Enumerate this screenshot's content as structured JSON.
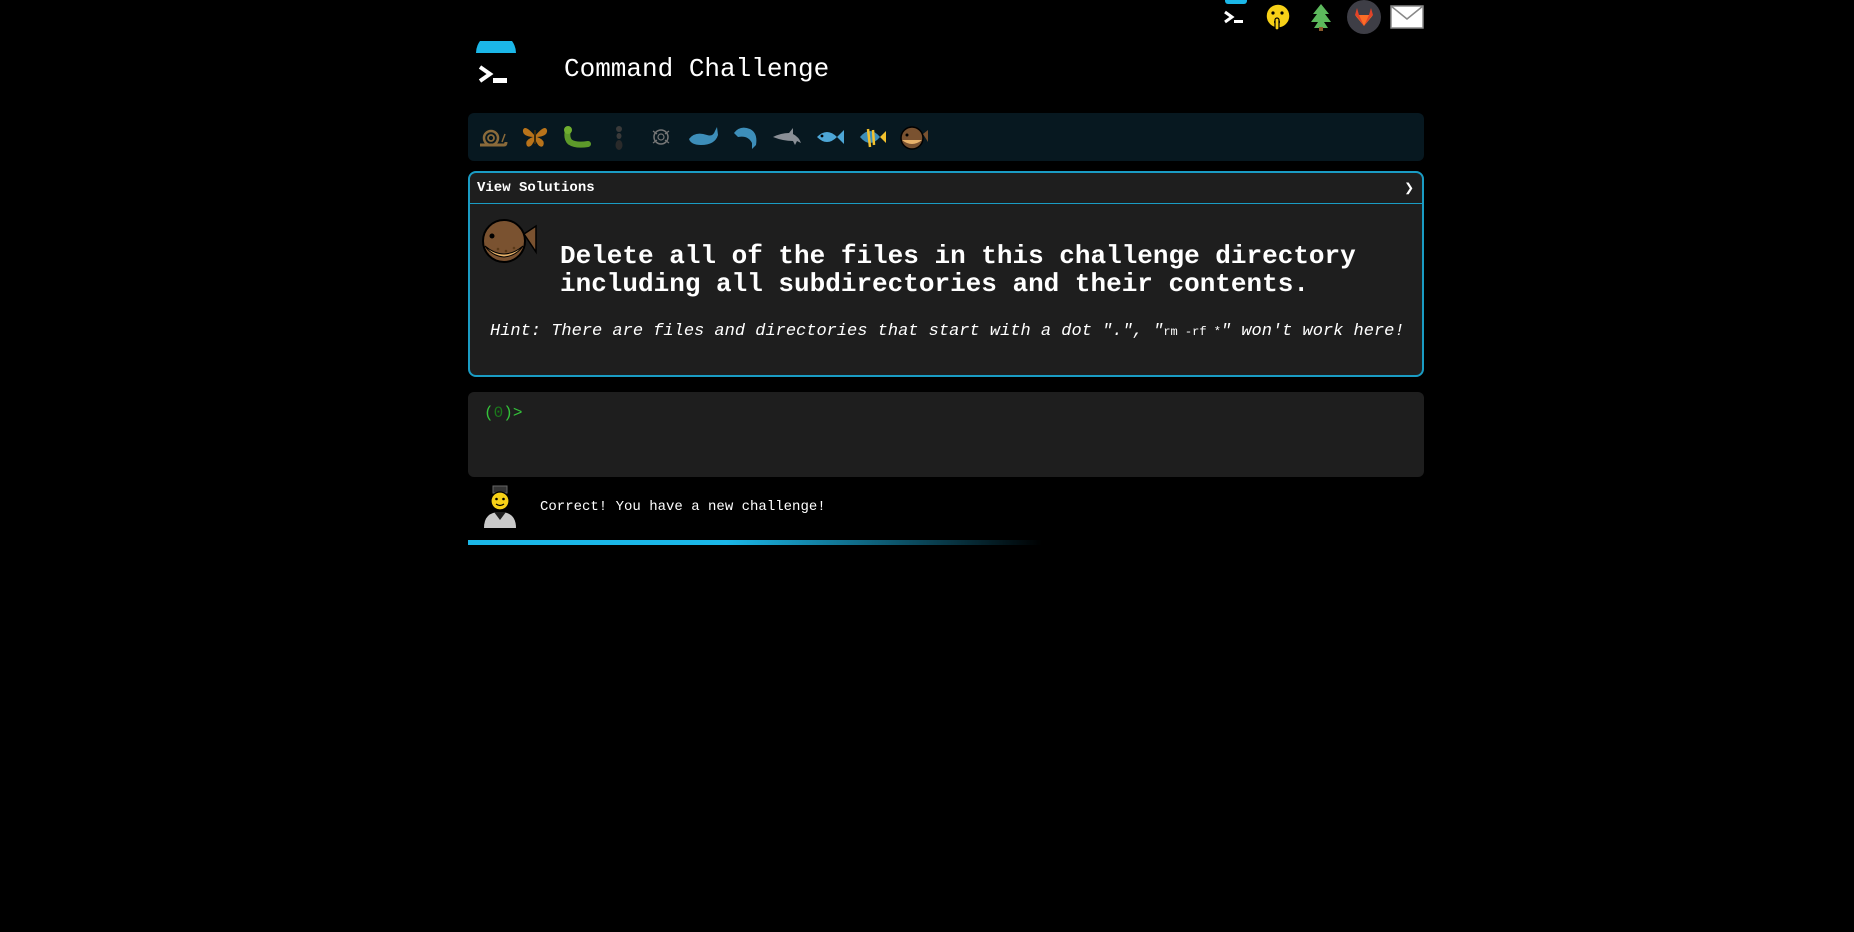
{
  "top_icons": [
    "terminal-icon",
    "shushing-face-icon",
    "christmas-tree-icon",
    "gitlab-icon",
    "mail-icon"
  ],
  "header": {
    "title": "Command Challenge"
  },
  "levels": [
    "snail",
    "butterfly",
    "caterpillar",
    "ant",
    "ant-outline",
    "whale",
    "dolphin",
    "dolphin-grey",
    "fish",
    "tropical-fish",
    "blowfish"
  ],
  "panel": {
    "toggle_label": "View Solutions",
    "toggle_chevron": "❯",
    "challenge": "Delete all of the files in this challenge directory\nincluding all subdirectories and their contents.",
    "hint_prefix": "Hint: There are files and directories that start with a dot \".\", \"",
    "hint_code": "rm -rf *",
    "hint_suffix": "\" won't work here!"
  },
  "terminal": {
    "prompt_open": "(",
    "prompt_count": "0",
    "prompt_close": ")>",
    "input_value": ""
  },
  "feedback": {
    "message": "Correct! You have a new challenge!"
  },
  "progress": {
    "fraction": 0.6
  },
  "colors": {
    "accent": "#1bb7e8",
    "prompt": "#34c23a",
    "panel_bg": "#1e1e1e",
    "level_bar_bg": "#071820"
  }
}
